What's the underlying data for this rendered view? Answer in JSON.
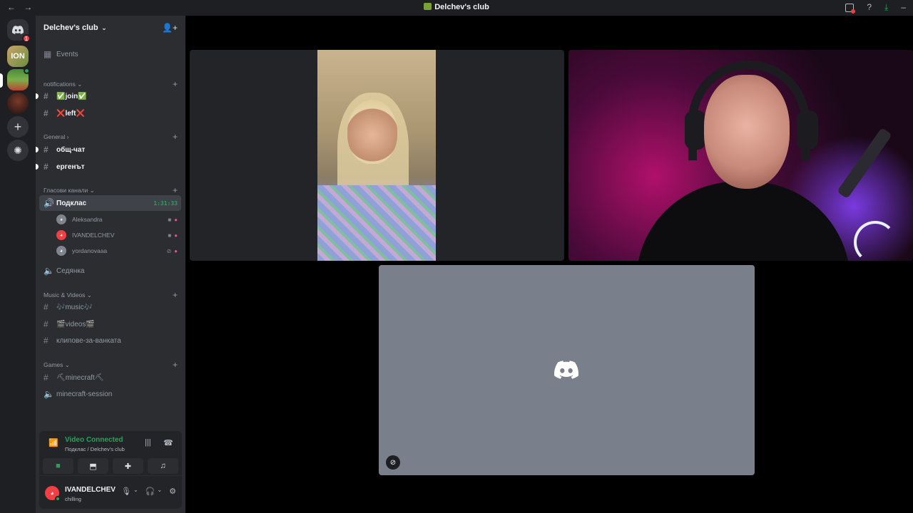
{
  "window": {
    "title": "Delchev's club",
    "back_icon": "←",
    "forward_icon": "→"
  },
  "servers": {
    "home_badge": "1",
    "ion_label": "ION"
  },
  "guild": {
    "name": "Delchev's club"
  },
  "sidebar": {
    "events": "Events",
    "categories": {
      "notifications": "notifications",
      "general": "General",
      "voice": "Гласови канали",
      "music": "Music & Videos",
      "games": "Games"
    },
    "channels": {
      "join": "✅join✅",
      "left": "❌left❌",
      "obsht_chat": "общ-чат",
      "ergenat": "ергенът",
      "podklas": "Подклас",
      "sedyanka": "Седянка",
      "music": "🎶music🎶",
      "videos": "🎬videos🎬",
      "klipove": "клипове-за-ванката",
      "minecraft": "⛏minecraft⛏",
      "minecraft_session": "minecraft-session"
    },
    "podklas_timer": "1:31:33",
    "voice_users": [
      {
        "name": "Aleksandra"
      },
      {
        "name": "IVANDELCHEV"
      },
      {
        "name": "yordanovaaa"
      }
    ]
  },
  "voice_panel": {
    "status": "Video Connected",
    "location": "Подклас / Delchev's club"
  },
  "user": {
    "name": "IVANDELCHEV",
    "status": "chilling"
  },
  "colors": {
    "connected_green": "#23a55a",
    "blurple": "#5865f2",
    "tile_gray": "#7a7f8c"
  }
}
